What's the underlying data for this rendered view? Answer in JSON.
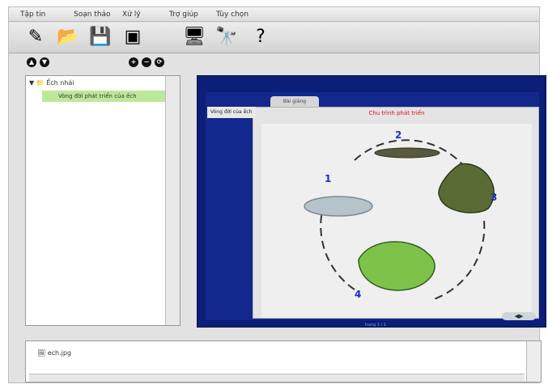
{
  "menu": [
    "Tập tin",
    "Soạn thảo",
    "Xử lý",
    "Trợ giúp",
    "Tùy chọn"
  ],
  "toolbar_icons": [
    {
      "name": "edit-icon"
    },
    {
      "name": "open-icon"
    },
    {
      "name": "save-icon"
    },
    {
      "name": "box-icon"
    },
    {
      "name": "monitor-icon"
    },
    {
      "name": "binocular-icon"
    },
    {
      "name": "help-icon"
    }
  ],
  "tree": {
    "root": "Ếch nhái",
    "child": "Vòng đời phát triển của ếch"
  },
  "viewer": {
    "tab": "Bài giảng",
    "left_tab": "Vòng đời của ếch",
    "title": "Chu trình phát triển",
    "labels": [
      "1",
      "2",
      "3",
      "4"
    ],
    "nav": "◀▶",
    "status": "trang 1 / 1"
  },
  "bottom": {
    "file": "ech.jpg"
  }
}
